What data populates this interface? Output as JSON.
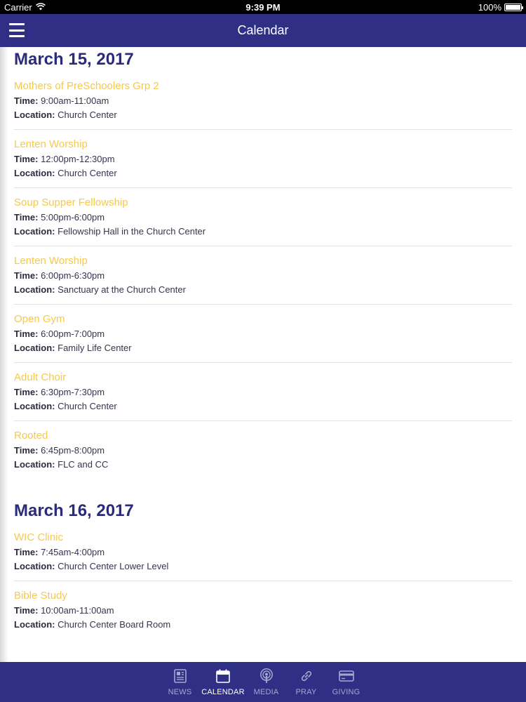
{
  "status_bar": {
    "carrier": "Carrier",
    "time": "9:39 PM",
    "battery": "100%",
    "battery_level": 1.0
  },
  "nav": {
    "title": "Calendar",
    "menu_icon": "hamburger-menu-icon"
  },
  "colors": {
    "brand": "#2f2f86",
    "event_title": "#f5c94e",
    "heading": "#2b2b7a"
  },
  "days": [
    {
      "date": "March 15, 2017",
      "events": [
        {
          "title": "Mothers of PreSchoolers Grp 2",
          "time_label": "Time:",
          "time": "9:00am-11:00am",
          "location_label": "Location:",
          "location": "Church Center"
        },
        {
          "title": "Lenten Worship",
          "time_label": "Time:",
          "time": "12:00pm-12:30pm",
          "location_label": "Location:",
          "location": "Church Center"
        },
        {
          "title": "Soup Supper Fellowship",
          "time_label": "Time:",
          "time": "5:00pm-6:00pm",
          "location_label": "Location:",
          "location": "Fellowship Hall in the Church Center"
        },
        {
          "title": "Lenten Worship",
          "time_label": "Time:",
          "time": "6:00pm-6:30pm",
          "location_label": "Location:",
          "location": "Sanctuary at the Church Center"
        },
        {
          "title": "Open Gym",
          "time_label": "Time:",
          "time": "6:00pm-7:00pm",
          "location_label": "Location:",
          "location": "Family Life Center"
        },
        {
          "title": "Adult Choir",
          "time_label": "Time:",
          "time": "6:30pm-7:30pm",
          "location_label": "Location:",
          "location": "Church Center"
        },
        {
          "title": "Rooted",
          "time_label": "Time:",
          "time": "6:45pm-8:00pm",
          "location_label": "Location:",
          "location": "FLC and CC"
        }
      ]
    },
    {
      "date": "March 16, 2017",
      "events": [
        {
          "title": "WIC Clinic",
          "time_label": "Time:",
          "time": "7:45am-4:00pm",
          "location_label": "Location:",
          "location": "Church Center Lower Level"
        },
        {
          "title": "Bible Study",
          "time_label": "Time:",
          "time": "10:00am-11:00am",
          "location_label": "Location:",
          "location": "Church Center Board Room"
        }
      ]
    }
  ],
  "tabs": [
    {
      "label": "NEWS",
      "icon": "news-icon",
      "active": false
    },
    {
      "label": "CALENDAR",
      "icon": "calendar-icon",
      "active": true
    },
    {
      "label": "MEDIA",
      "icon": "podcast-icon",
      "active": false
    },
    {
      "label": "PRAY",
      "icon": "link-icon",
      "active": false
    },
    {
      "label": "GIVING",
      "icon": "credit-card-icon",
      "active": false
    }
  ]
}
